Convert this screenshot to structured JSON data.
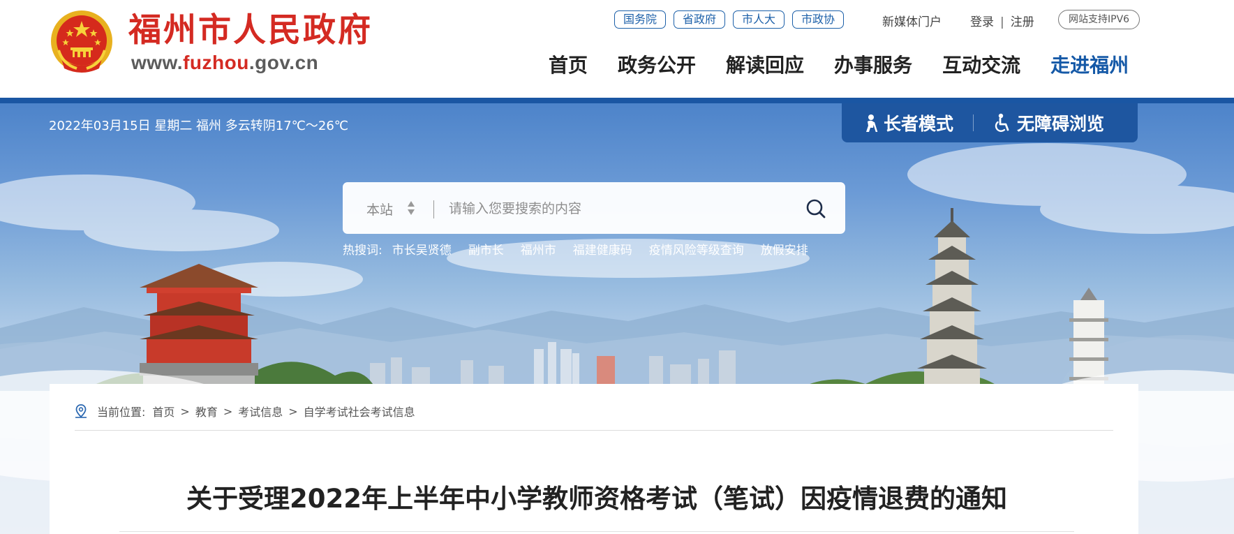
{
  "header": {
    "site_title": "福州市人民政府",
    "site_domain_prefix": "www.",
    "site_domain_highlight": "fuzhou",
    "site_domain_suffix": ".gov.cn",
    "top_links": [
      "国务院",
      "省政府",
      "市人大",
      "市政协"
    ],
    "media_link": "新媒体门户",
    "login": "登录",
    "login_sep": "|",
    "register": "注册",
    "ipv6_badge": "网站支持IPV6",
    "nav": [
      "首页",
      "政务公开",
      "解读回应",
      "办事服务",
      "互动交流",
      "走进福州"
    ]
  },
  "banner": {
    "date_weather": "2022年03月15日 星期二 福州 多云转阴17℃～26℃",
    "elder_mode": "长者模式",
    "accessible_mode": "无障碍浏览",
    "search": {
      "scope": "本站",
      "placeholder": "请输入您要搜索的内容",
      "value": ""
    },
    "hot_label": "热搜词:",
    "hot_words": [
      "市长吴贤德",
      "副市长",
      "福州市",
      "福建健康码",
      "疫情风险等级查询",
      "放假安排"
    ]
  },
  "content": {
    "breadcrumb_label": "当前位置:",
    "breadcrumb": [
      "首页",
      "教育",
      "考试信息",
      "自学考试社会考试信息"
    ],
    "breadcrumb_separator": ">",
    "article_title": "关于受理2022年上半年中小学教师资格考试（笔试）因疫情退费的通知"
  },
  "colors": {
    "brand_red": "#d42a22",
    "brand_blue": "#1559a7",
    "mode_bar": "#1e56a0"
  },
  "icons": [
    "national-emblem",
    "elder-person-icon",
    "wheelchair-icon",
    "sort-arrows-icon",
    "search-icon",
    "location-pin-icon"
  ]
}
